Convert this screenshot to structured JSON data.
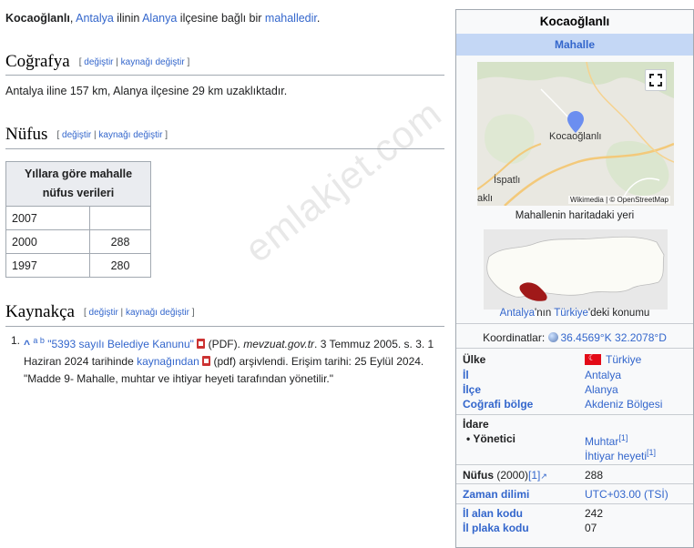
{
  "intro": {
    "subject": "Kocaoğlanlı",
    "t1": ", ",
    "il_link": "Antalya",
    "t2": " ilinin ",
    "ilce_link": "Alanya",
    "t3": " ilçesine bağlı bir ",
    "mah_link": "mahalledir",
    "t4": "."
  },
  "sections": {
    "cografya": {
      "title": "Coğrafya",
      "text": "Antalya iline 157 km, Alanya ilçesine 29 km uzaklıktadır."
    },
    "nufus": {
      "title": "Nüfus"
    },
    "kaynakca": {
      "title": "Kaynakça"
    },
    "edit": {
      "open": "[ ",
      "edit_label": "değiştir",
      "pipe": " | ",
      "source_label": "kaynağı değiştir",
      "close": " ]"
    }
  },
  "population_table": {
    "header": "Yıllara göre mahalle nüfus verileri",
    "rows": [
      {
        "year": "2007",
        "value": ""
      },
      {
        "year": "2000",
        "value": "288"
      },
      {
        "year": "1997",
        "value": "280"
      }
    ]
  },
  "reference": {
    "num": "1.",
    "caret": "^",
    "a": "a",
    "b": "b",
    "link": "\"5393 sayılı Belediye Kanunu\"",
    "pdf": " (PDF). ",
    "site": "mevzuat.gov.tr",
    "t1": ". 3 Temmuz 2005. s. 3. 1 Haziran 2024 tarihinde ",
    "archive_link": "kaynağından",
    "pdf2": " (pdf) ",
    "t2": "arşivlendi. Erişim tarihi: 25 Eylül 2024.",
    "quote": "\"Madde 9- Mahalle, muhtar ve ihtiyar heyeti tarafından yönetilir.\""
  },
  "watermark": "emlakjet.com",
  "infobox": {
    "title": "Kocaoğlanlı",
    "subtitle": "Mahalle",
    "map": {
      "label_main": "Kocaoğlanlı",
      "label_2": "İspatlı",
      "label_3": "aklı",
      "attr_wiki": "Wikimedia",
      "attr_sep": " | © ",
      "attr_osm": "OpenStreetMap"
    },
    "map_caption": "Mahallenin haritadaki yeri",
    "turkey_caption": {
      "l1": "Antalya",
      "t1": "'nın ",
      "l2": "Türkiye",
      "t2": "'deki konumu"
    },
    "coord_label": "Koordinatlar: ",
    "coord_value": "36.4569°K 32.2078°D",
    "ulke": {
      "label": "Ülke",
      "value": "Türkiye"
    },
    "il": {
      "label": "İl",
      "value": "Antalya"
    },
    "ilce": {
      "label": "İlçe",
      "value": "Alanya"
    },
    "bolge": {
      "label": "Coğrafi bölge",
      "value": "Akdeniz Bölgesi"
    },
    "idare": "İdare",
    "yonetici": {
      "label": "• Yönetici",
      "v1": "Muhtar",
      "v2": "İhtiyar heyeti",
      "ref": "[1]"
    },
    "nufus": {
      "label": "Nüfus",
      "year": " (2000)",
      "ref": "[1]",
      "value": "288"
    },
    "zaman": {
      "label": "Zaman dilimi",
      "value": "UTC+03.00 (TSİ)"
    },
    "alan": {
      "label": "İl alan kodu",
      "value": "242"
    },
    "plaka": {
      "label": "İl plaka kodu",
      "value": "07"
    }
  }
}
